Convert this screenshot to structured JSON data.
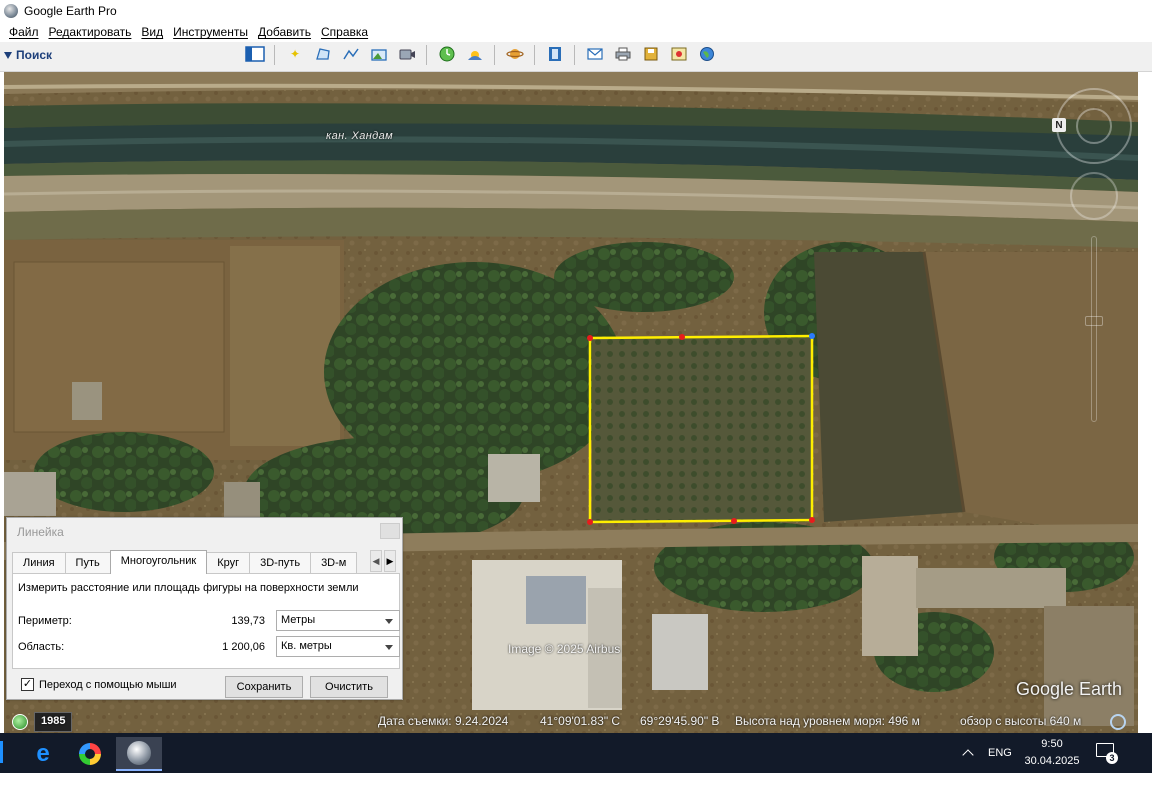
{
  "window": {
    "title": "Google Earth Pro"
  },
  "menu": [
    "Файл",
    "Редактировать",
    "Вид",
    "Инструменты",
    "Добавить",
    "Справка"
  ],
  "search_panel": {
    "label": "Поиск"
  },
  "toolbar": {
    "icons": [
      "sidebar-toggle-icon",
      "add-placemark-icon",
      "add-polygon-icon",
      "add-path-icon",
      "add-image-overlay-icon",
      "record-tour-icon",
      "historical-imagery-icon",
      "sunlight-icon",
      "planets-icon",
      "ruler-icon",
      "email-icon",
      "print-icon",
      "save-image-icon",
      "view-in-maps-icon",
      "earth-icon"
    ]
  },
  "map": {
    "canal_label": "кан. Хандам",
    "image_credit": "Image © 2025 Airbus",
    "logo_text": "Google Earth",
    "compass_letter": "N"
  },
  "status": {
    "historical_year": "1985",
    "imagery_date": "Дата съемки: 9.24.2024",
    "latitude": "41°09'01.83\" С",
    "longitude": "69°29'45.90\" В",
    "elevation": "Высота над уровнем моря:   496 м",
    "eye_alt": "обзор с высоты   640 м"
  },
  "ruler": {
    "title": "Линейка",
    "tabs": [
      "Линия",
      "Путь",
      "Многоугольник",
      "Круг",
      "3D-путь",
      "3D-м"
    ],
    "active_tab": "Многоугольник",
    "description": "Измерить расстояние или площадь фигуры на поверхности земли",
    "perimeter": {
      "label": "Периметр:",
      "value": "139,73",
      "unit": "Метры"
    },
    "area": {
      "label": "Область:",
      "value": "1 200,06",
      "unit": "Кв. метры"
    },
    "mouse_navigation": {
      "label": "Переход с помощью мыши",
      "checked": true
    },
    "save_label": "Сохранить",
    "clear_label": "Очистить"
  },
  "taskbar": {
    "apps": [
      "edge-icon",
      "photos-icon",
      "google-earth-pro-icon"
    ],
    "language": "ENG",
    "time": "9:50",
    "date": "30.04.2025",
    "notification_count": "3"
  },
  "colors": {
    "polygon_outline": "#ffee00",
    "polygon_vertex": "#e81c1c",
    "taskbar": "#121a29",
    "dialog": "#f0f0f0"
  }
}
